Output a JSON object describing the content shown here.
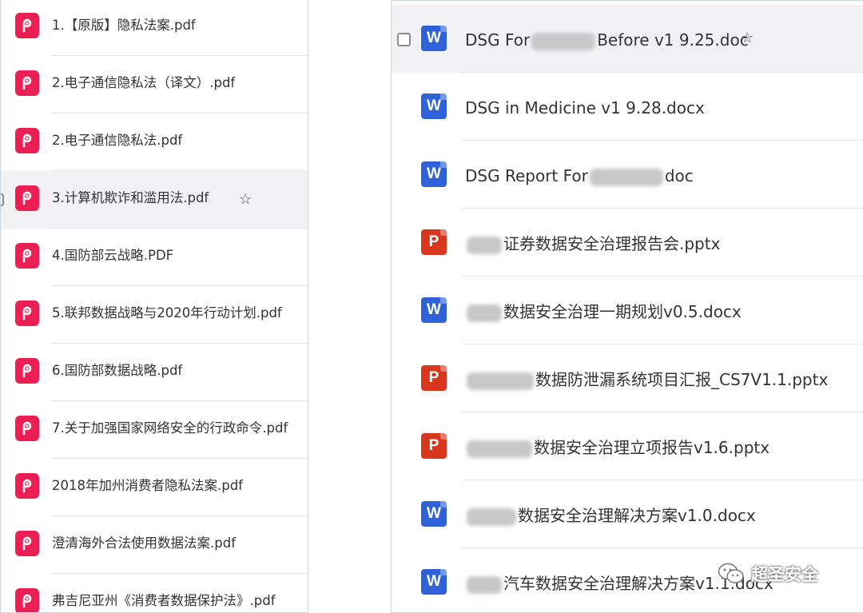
{
  "left_panel": {
    "files": [
      {
        "type": "pdf",
        "icon": "pdf-icon",
        "name": "1.【原版】隐私法案.pdf"
      },
      {
        "type": "pdf",
        "icon": "pdf-icon",
        "name": "2.电子通信隐私法（译文）.pdf"
      },
      {
        "type": "pdf",
        "icon": "pdf-icon",
        "name": "2.电子通信隐私法.pdf"
      },
      {
        "type": "pdf",
        "icon": "pdf-icon",
        "name": "3.计算机欺诈和滥用法.pdf",
        "hover": true
      },
      {
        "type": "pdf",
        "icon": "pdf-icon",
        "name": "4.国防部云战略.PDF"
      },
      {
        "type": "pdf",
        "icon": "pdf-icon",
        "name": "5.联邦数据战略与2020年行动计划.pdf"
      },
      {
        "type": "pdf",
        "icon": "pdf-icon",
        "name": "6.国防部数据战略.pdf"
      },
      {
        "type": "pdf",
        "icon": "pdf-icon",
        "name": "7.关于加强国家网络安全的行政命令.pdf"
      },
      {
        "type": "pdf",
        "icon": "pdf-icon",
        "name": "2018年加州消费者隐私法案.pdf"
      },
      {
        "type": "pdf",
        "icon": "pdf-icon",
        "name": "澄清海外合法使用数据法案.pdf"
      },
      {
        "type": "pdf",
        "icon": "pdf-icon",
        "name": "弗吉尼亚州《消费者数据保护法》.pdf"
      }
    ]
  },
  "right_panel": {
    "files": [
      {
        "type": "word",
        "icon_letter": "W",
        "name_a": "DSG For",
        "name_b": "Before v1 9.25.doc",
        "hover": true
      },
      {
        "type": "word",
        "icon_letter": "W",
        "name_a": "DSG in Medicine v1 9.28.docx",
        "name_b": ""
      },
      {
        "type": "word",
        "icon_letter": "W",
        "name_a": "DSG Report For",
        "name_b": "doc"
      },
      {
        "type": "ppt",
        "icon_letter": "P",
        "name_a": "",
        "name_b": "证券数据安全治理报告会.pptx"
      },
      {
        "type": "word",
        "icon_letter": "W",
        "name_a": "",
        "name_b": "数据安全治理一期规划v0.5.docx"
      },
      {
        "type": "ppt",
        "icon_letter": "P",
        "name_a": "",
        "name_b": "数据防泄漏系统项目汇报_CS7V1.1.pptx"
      },
      {
        "type": "ppt",
        "icon_letter": "P",
        "name_a": "",
        "name_b": "数据安全治理立项报告v1.6.pptx"
      },
      {
        "type": "word",
        "icon_letter": "W",
        "name_a": "",
        "name_b": "数据安全治理解决方案v1.0.docx"
      },
      {
        "type": "word",
        "icon_letter": "W",
        "name_a": "",
        "name_b": "汽车数据安全治理解决方案v1.1.docx"
      }
    ]
  },
  "watermark": {
    "text": "超圣安全",
    "icon": "wechat-icon"
  },
  "colors": {
    "pdf": "#ec1f55",
    "word": "#2f62d8",
    "ppt": "#d9361e",
    "hover_row": "#f2f2f4"
  }
}
